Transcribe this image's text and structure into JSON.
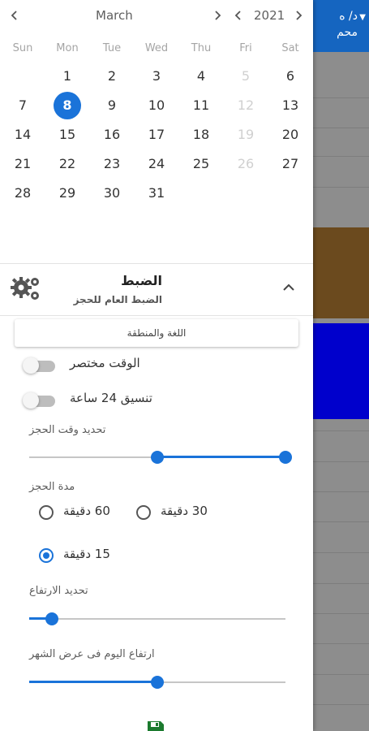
{
  "background_app": {
    "header_text_line1": "د/ ه",
    "header_text_line2": "محم",
    "colors": {
      "header": "#1565c0",
      "block_brown": "#6b4a1e",
      "block_blue": "#0000cc",
      "dim": "#8d8d8d"
    }
  },
  "calendar": {
    "month": "March",
    "year": "2021",
    "weekdays": [
      "Sun",
      "Mon",
      "Tue",
      "Wed",
      "Thu",
      "Fri",
      "Sat"
    ],
    "weeks": [
      [
        "",
        "1",
        "2",
        "3",
        "4",
        "5",
        "6"
      ],
      [
        "7",
        "8",
        "9",
        "10",
        "11",
        "12",
        "13"
      ],
      [
        "14",
        "15",
        "16",
        "17",
        "18",
        "19",
        "20"
      ],
      [
        "21",
        "22",
        "23",
        "24",
        "25",
        "26",
        "27"
      ],
      [
        "28",
        "29",
        "30",
        "31",
        "",
        "",
        ""
      ]
    ],
    "selected_day": "8",
    "disabled_weekday_index": 5,
    "accent_color": "#1a73d9"
  },
  "settings": {
    "title": "الضبط",
    "subtitle": "الضبط العام للحجز",
    "language_button": "اللغة والمنطقة",
    "toggles": [
      {
        "label": "الوقت مختصر",
        "on": false
      },
      {
        "label": "تنسيق 24 ساعة",
        "on": false
      }
    ],
    "booking_time_label": "تحديد وقت الحجز",
    "booking_time_range": [
      0.5,
      1.0
    ],
    "duration_label": "مدة الحجز",
    "duration_options": [
      "60 دقيقة",
      "30 دقيقة",
      "15 دقيقة"
    ],
    "duration_selected": "15 دقيقة",
    "height_label": "تحديد الارتفاع",
    "height_value": 0.09,
    "month_day_height_label": "ارتفاع اليوم فى عرض الشهر",
    "month_day_height_value": 0.5
  },
  "icons": {
    "prev_month": "chevron-left-icon",
    "next_month": "chevron-right-icon",
    "prev_year": "chevron-left-icon",
    "next_year": "chevron-right-icon",
    "settings": "gears-icon",
    "collapse": "chevron-up-icon",
    "save": "floppy-disk-icon"
  }
}
